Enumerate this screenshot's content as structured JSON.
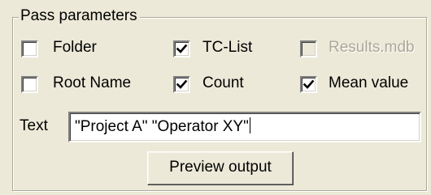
{
  "group": {
    "caption": "Pass parameters"
  },
  "checkboxes": [
    {
      "label": "Folder",
      "checked": false,
      "enabled": true
    },
    {
      "label": "TC-List",
      "checked": true,
      "enabled": true
    },
    {
      "label": "Results.mdb",
      "checked": false,
      "enabled": false
    },
    {
      "label": "Root Name",
      "checked": false,
      "enabled": true
    },
    {
      "label": "Count",
      "checked": true,
      "enabled": true
    },
    {
      "label": "Mean value",
      "checked": true,
      "enabled": true
    }
  ],
  "text_field": {
    "label": "Text",
    "value": "\"Project A\" \"Operator XY\""
  },
  "preview_button": {
    "label": "Preview output"
  },
  "colors": {
    "window_background": "#ece9d8",
    "disabled_text": "#aca899"
  },
  "icons": {
    "check": "checkmark-icon"
  }
}
